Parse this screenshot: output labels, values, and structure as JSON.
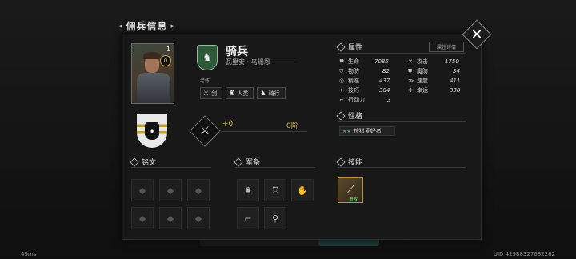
{
  "screen_title": "佣兵信息",
  "unit": {
    "name": "骑兵",
    "subname": "瓦里安 · 乌瑞恩",
    "class_sub": "老练",
    "level": "1",
    "star_badge": "0",
    "tags": [
      {
        "label": "剑",
        "icon": "sword-icon"
      },
      {
        "label": "人类",
        "icon": "helmet-icon"
      },
      {
        "label": "骑行",
        "icon": "horse-icon"
      }
    ]
  },
  "weapon": {
    "plus": "+0",
    "rank": "0阶"
  },
  "sections": {
    "attributes": "属性",
    "attributes_detail": "属性详情",
    "personality": "性格",
    "inscription": "铭文",
    "equipment": "军备",
    "skills": "技能"
  },
  "stats": [
    {
      "label": "生命",
      "value": "7085",
      "icon": "heart-icon"
    },
    {
      "label": "攻击",
      "value": "1750",
      "icon": "crossed-swords-icon"
    },
    {
      "label": "物防",
      "value": "82",
      "icon": "shield-icon"
    },
    {
      "label": "魔防",
      "value": "34",
      "icon": "magic-shield-icon"
    },
    {
      "label": "精准",
      "value": "437",
      "icon": "target-icon"
    },
    {
      "label": "速度",
      "value": "411",
      "icon": "speed-icon"
    },
    {
      "label": "技巧",
      "value": "384",
      "icon": "skill-icon"
    },
    {
      "label": "幸运",
      "value": "338",
      "icon": "clover-icon"
    },
    {
      "label": "行动力",
      "value": "3",
      "icon": "boot-icon"
    }
  ],
  "personality": {
    "stars": "★★",
    "label": "狩猎爱好者"
  },
  "skill": {
    "tag": "普攻",
    "icon": "claw-slash-icon"
  },
  "footer": {
    "fps": "49ms",
    "uid": "UID 42988327682262"
  }
}
